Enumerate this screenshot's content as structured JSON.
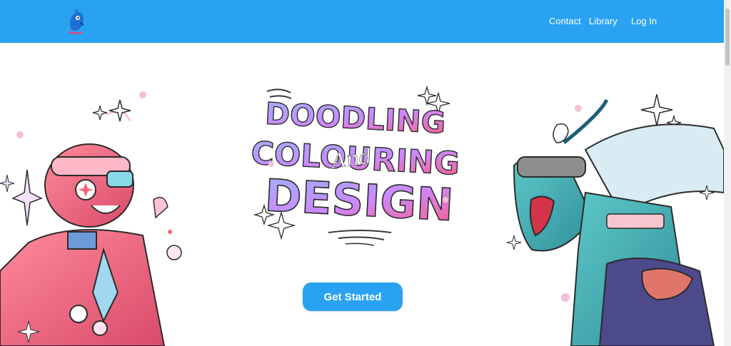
{
  "nav": {
    "links": [
      "Contact",
      "Library",
      "Log In"
    ]
  },
  "hero": {
    "title_lines": [
      "DOODLING",
      "COLOURING",
      "DESIGN"
    ],
    "script_word": "And",
    "cta_label": "Get Started"
  },
  "colors": {
    "header_bg": "#2aa2f2",
    "cta_bg": "#2aa2f2",
    "text_on_blue": "#ffffff"
  },
  "icons": {
    "logo": "blue-mascot-logo"
  }
}
